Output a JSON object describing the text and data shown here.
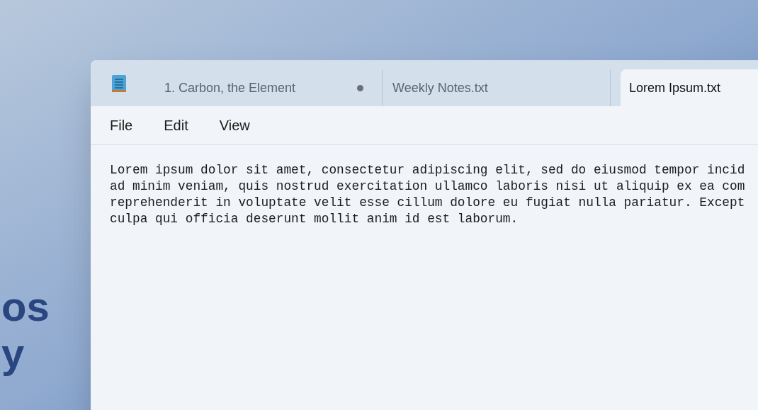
{
  "background_text": [
    "os",
    "y"
  ],
  "window": {
    "tabs": [
      {
        "label": "1. Carbon, the Element",
        "modified": true,
        "selected": false
      },
      {
        "label": "Weekly Notes.txt",
        "modified": false,
        "selected": false
      },
      {
        "label": "Lorem Ipsum.txt",
        "modified": false,
        "selected": true
      }
    ],
    "menu": [
      "File",
      "Edit",
      "View"
    ],
    "document_lines": [
      "Lorem ipsum dolor sit amet, consectetur adipiscing elit, sed do eiusmod tempor incid",
      "ad minim veniam, quis nostrud exercitation ullamco laboris nisi ut aliquip ex ea com",
      "reprehenderit in voluptate velit esse cillum dolore eu fugiat nulla pariatur. Except",
      "culpa qui officia deserunt mollit anim id est laborum."
    ]
  }
}
